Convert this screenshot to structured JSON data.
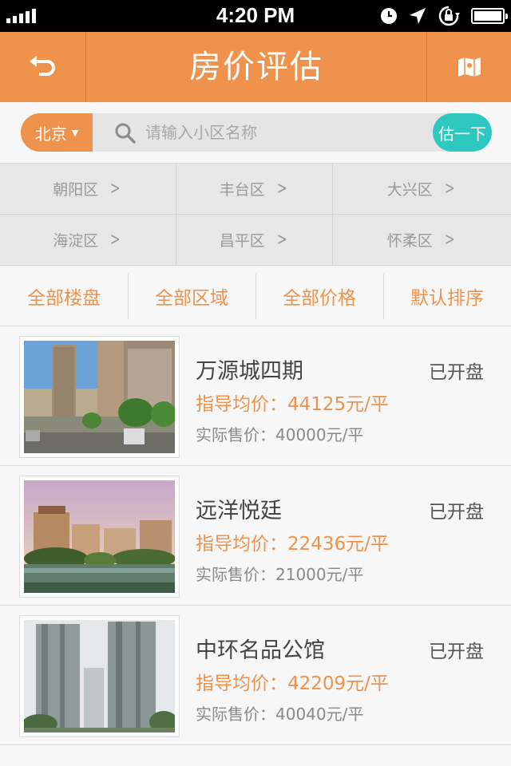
{
  "status_bar": {
    "time": "4:20 PM",
    "icons": [
      "signal-icon",
      "clock-icon",
      "location-icon",
      "rotation-lock-icon",
      "battery-icon"
    ]
  },
  "header": {
    "title": "房价评估",
    "back_icon": "back-arrow-icon",
    "map_icon": "map-icon",
    "background": "#ef924b"
  },
  "search": {
    "city": "北京",
    "placeholder": "请输入小区名称",
    "estimate_label": "估一下",
    "estimate_color": "#2fc8c1"
  },
  "districts": [
    "朝阳区",
    "丰台区",
    "大兴区",
    "海淀区",
    "昌平区",
    "怀柔区"
  ],
  "filters": [
    "全部楼盘",
    "全部区域",
    "全部价格",
    "默认排序"
  ],
  "listings": [
    {
      "name": "万源城四期",
      "status": "已开盘",
      "guide_price": "指导均价：44125元/平",
      "actual_price": "实际售价：40000元/平"
    },
    {
      "name": "远洋悦廷",
      "status": "已开盘",
      "guide_price": "指导均价：22436元/平",
      "actual_price": "实际售价：21000元/平"
    },
    {
      "name": "中环名品公馆",
      "status": "已开盘",
      "guide_price": "指导均价：42209元/平",
      "actual_price": "实际售价：40040元/平"
    }
  ],
  "colors": {
    "accent": "#ef924b",
    "teal": "#2fc8c1"
  }
}
